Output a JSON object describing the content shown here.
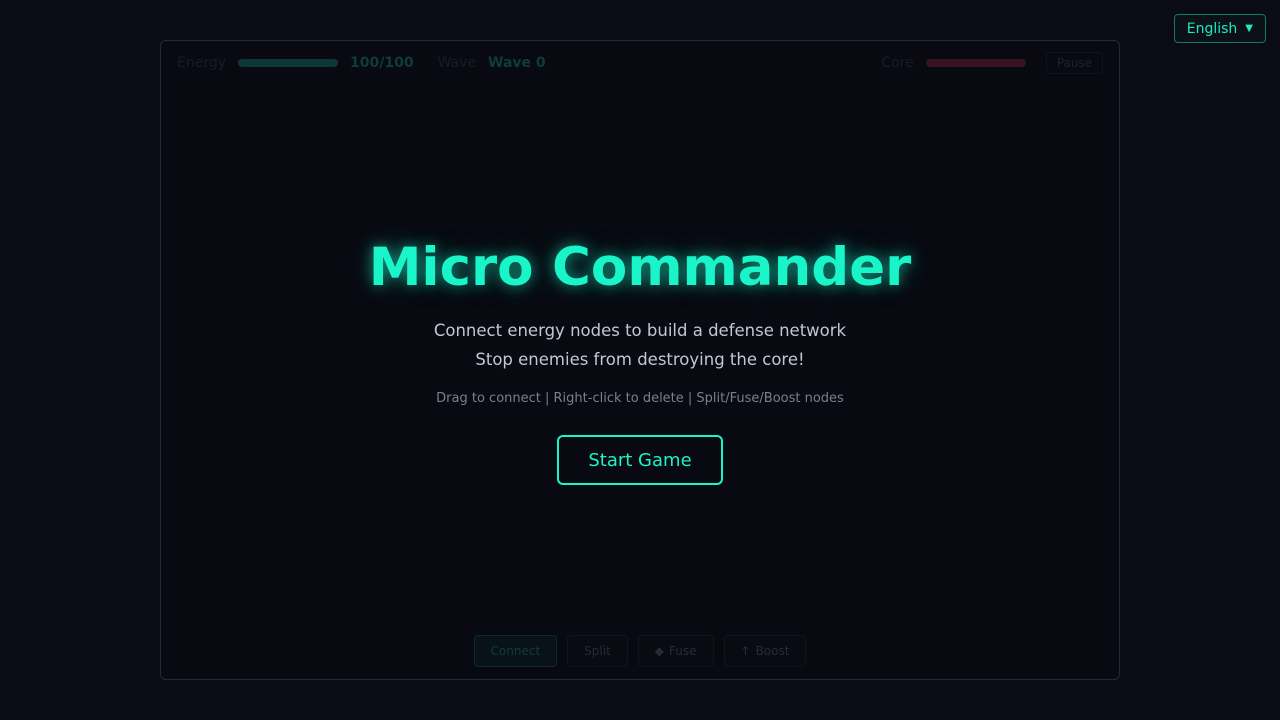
{
  "language": {
    "selected": "English",
    "caret": "▼"
  },
  "hud": {
    "energy_label": "Energy",
    "energy_value": "100/100",
    "energy_level": 1.0,
    "wave_label": "Wave",
    "wave_value": "Wave 0",
    "core_label": "Core",
    "core_level": 1.0,
    "pause_label": "Pause"
  },
  "tools": [
    {
      "label": "Connect",
      "icon": ""
    },
    {
      "label": "Split",
      "icon": ""
    },
    {
      "label": "Fuse",
      "icon": "◆"
    },
    {
      "label": "Boost",
      "icon": "↑"
    }
  ],
  "overlay": {
    "title": "Micro Commander",
    "subtitle_line1": "Connect energy nodes to build a defense network",
    "subtitle_line2": "Stop enemies from destroying the core!",
    "hint": "Drag to connect | Right-click to delete | Split/Fuse/Boost nodes",
    "start_label": "Start Game"
  },
  "colors": {
    "accent": "#19f5c9",
    "background": "#0a0b14",
    "core_bar": "#b0304e"
  }
}
